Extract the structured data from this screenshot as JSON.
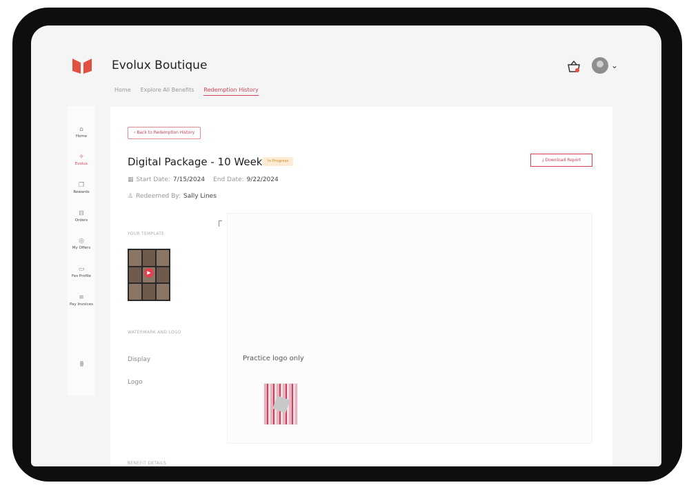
{
  "app": {
    "brand": "Evolux Boutique",
    "accent_color": "#d64055"
  },
  "topnav": {
    "items": [
      "Home",
      "Explore All Benefits",
      "Redemption History"
    ],
    "active": "Redemption History"
  },
  "header": {
    "cart_icon": "shopping-basket-icon",
    "avatar_icon": "user-avatar-icon",
    "menu_icon": "chevron-down-icon"
  },
  "sidebar": {
    "items": [
      {
        "label": "Home",
        "icon": "home-icon"
      },
      {
        "label": "Evolux",
        "icon": "sparkle-icon",
        "active": true
      },
      {
        "label": "Rewards",
        "icon": "gift-icon"
      },
      {
        "label": "Orders",
        "icon": "bag-icon"
      },
      {
        "label": "My Offers",
        "icon": "tag-icon"
      },
      {
        "label": "Fes Profile",
        "icon": "profile-icon"
      },
      {
        "label": "Pay Invoices",
        "icon": "invoice-icon"
      }
    ]
  },
  "detail": {
    "back_label": "Back to Redemption History",
    "title": "Digital Package - 10 Weeks",
    "status_badge": "In Progress",
    "download_label": "Download Report",
    "start_date_label": "Start Date:",
    "start_date": "7/15/2024",
    "end_date_label": "End Date:",
    "end_date": "9/22/2024",
    "redeemed_by_label": "Redeemed By:",
    "redeemed_by": "Sally Lines"
  },
  "sections": {
    "template_heading": "YOUR TEMPLATE",
    "branding_heading": "WATERMARK AND LOGO",
    "display_label": "Display",
    "display_value": "Practice logo only",
    "logo_label": "Logo",
    "benefit_heading": "BENEFIT DETAILS"
  }
}
